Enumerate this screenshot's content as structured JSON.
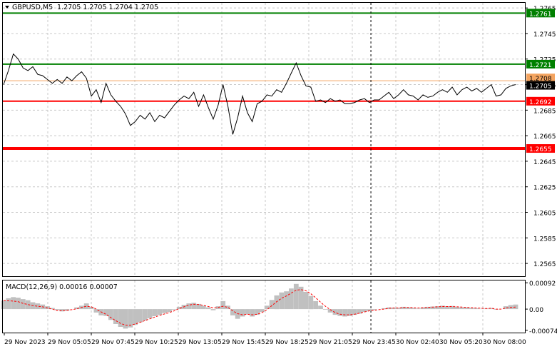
{
  "window": {
    "symbol_label": "GBPUSD,M5",
    "ohlc_label": "1.2705 1.2705 1.2704 1.2705",
    "dropdown_icon": "triangle-down-icon"
  },
  "colors": {
    "background": "#ffffff",
    "grid": "#c8c8c8",
    "price_line": "#000000",
    "support_resistance_red": "#ff0000",
    "target_green": "#008000",
    "ask_orange": "#f4a460",
    "macd_hist": "#c0c0c0",
    "macd_signal": "#ff0000",
    "border": "#000000"
  },
  "chart_data": [
    {
      "type": "line",
      "title": "GBPUSD,M5",
      "ylim": [
        1.2555,
        1.2769
      ],
      "y_ticks": [
        "1.2765",
        "1.2745",
        "1.2725",
        "1.2705",
        "1.2685",
        "1.2665",
        "1.2645",
        "1.2625",
        "1.2605",
        "1.2585",
        "1.2565"
      ],
      "x_ticks": [
        "29 Nov 2023",
        "29 Nov 05:05",
        "29 Nov 07:45",
        "29 Nov 10:25",
        "29 Nov 13:05",
        "29 Nov 15:45",
        "29 Nov 18:25",
        "29 Nov 21:05",
        "29 Nov 23:45",
        "30 Nov 02:40",
        "30 Nov 05:20",
        "30 Nov 08:00"
      ],
      "series": [
        {
          "values": [
            1.2705,
            1.2716,
            1.2729,
            1.2725,
            1.2718,
            1.2716,
            1.2719,
            1.2713,
            1.2712,
            1.2709,
            1.2706,
            1.2709,
            1.2706,
            1.2711,
            1.2708,
            1.2712,
            1.2715,
            1.271,
            1.2696,
            1.2701,
            1.2691,
            1.2706,
            1.2697,
            1.2692,
            1.2688,
            1.2682,
            1.2673,
            1.2676,
            1.2681,
            1.2678,
            1.2683,
            1.2676,
            1.2681,
            1.2679,
            1.2684,
            1.2689,
            1.2693,
            1.2696,
            1.2694,
            1.2699,
            1.2688,
            1.2697,
            1.2687,
            1.2678,
            1.2689,
            1.2705,
            1.2688,
            1.2666,
            1.2679,
            1.2696,
            1.2683,
            1.2676,
            1.269,
            1.2692,
            1.2697,
            1.2696,
            1.2701,
            1.2699,
            1.2706,
            1.2714,
            1.2722,
            1.2712,
            1.2704,
            1.2703,
            1.2692,
            1.2693,
            1.2691,
            1.2694,
            1.2692,
            1.2693,
            1.269,
            1.269,
            1.2691,
            1.2693,
            1.2694,
            1.2691,
            1.2693,
            1.2693,
            1.2696,
            1.2699,
            1.2694,
            1.2697,
            1.2701,
            1.2697,
            1.2696,
            1.2693,
            1.2697,
            1.2695,
            1.2696,
            1.2699,
            1.2701,
            1.2699,
            1.2703,
            1.2697,
            1.2701,
            1.2703,
            1.27,
            1.2702,
            1.2699,
            1.2702,
            1.2705,
            1.2696,
            1.2697,
            1.2702,
            1.2704,
            1.2705
          ]
        }
      ],
      "levels": [
        {
          "label": "1.2761",
          "value": 1.2761,
          "color": "green"
        },
        {
          "label": "1.2721",
          "value": 1.2721,
          "color": "green"
        },
        {
          "label": "1.2708",
          "value": 1.2708,
          "color": "orange"
        },
        {
          "label": "1.2705",
          "value": 1.2705,
          "color": "black"
        },
        {
          "label": "1.2692",
          "value": 1.2692,
          "color": "red"
        },
        {
          "label": "1.2655",
          "value": 1.2655,
          "color": "red"
        }
      ],
      "vertical_marker_fraction": 0.705,
      "grid": true
    },
    {
      "type": "bar",
      "title": "MACD(12,26,9) 0.00016 0.00007",
      "ylim": [
        -0.00082,
        0.001
      ],
      "y_ticks": [
        "0.00092",
        "0.00",
        "-0.00074"
      ],
      "histogram": [
        0.0003,
        0.00038,
        0.00042,
        0.0004,
        0.00035,
        0.00031,
        0.00024,
        0.0002,
        0.00016,
        0.0001,
        4e-05,
        -3e-05,
        -8e-05,
        -6e-05,
        0.0,
        6e-05,
        0.00012,
        0.0002,
        8e-05,
        -0.00012,
        -0.00022,
        -0.00024,
        -0.00038,
        -0.00052,
        -0.00062,
        -0.00068,
        -0.00064,
        -0.00055,
        -0.00046,
        -0.0004,
        -0.00032,
        -0.00025,
        -0.0002,
        -0.00014,
        -0.0001,
        -2e-05,
        8e-05,
        0.00015,
        0.0002,
        0.00022,
        0.00018,
        0.00012,
        6e-05,
        -4e-05,
        0.0001,
        0.00028,
        0.00012,
        -0.00022,
        -0.00034,
        -0.00026,
        -0.00018,
        -0.00026,
        -0.0002,
        -0.0001,
        0.00012,
        0.00032,
        0.00048,
        0.00058,
        0.00062,
        0.00072,
        0.00088,
        0.00078,
        0.0006,
        0.00046,
        0.00028,
        0.00012,
        -2e-05,
        -0.00012,
        -0.0002,
        -0.00024,
        -0.00026,
        -0.00024,
        -0.0002,
        -0.00016,
        -0.0001,
        -6e-05,
        -3e-05,
        0.0,
        3e-05,
        6e-05,
        5e-05,
        4e-05,
        8e-05,
        6e-05,
        4e-05,
        2e-05,
        6e-05,
        8e-05,
        9e-05,
        0.0001,
        0.00012,
        0.0001,
        0.00011,
        8e-05,
        6e-05,
        6e-05,
        4e-05,
        3e-05,
        1e-05,
        2e-05,
        4e-05,
        -2e-05,
        0.0,
        0.0001,
        0.00014,
        0.00016
      ],
      "signal": [
        0.0003,
        0.00029,
        0.00028,
        0.00026,
        0.0002,
        0.00016,
        0.00012,
        0.0001,
        8e-05,
        4e-05,
        0.0,
        -5e-05,
        -6e-05,
        -4e-05,
        -2e-05,
        1e-05,
        6e-05,
        0.0001,
        8e-05,
        0.0,
        -0.0001,
        -0.00018,
        -0.0003,
        -0.0004,
        -0.0005,
        -0.00056,
        -0.00056,
        -0.00052,
        -0.00046,
        -0.0004,
        -0.00034,
        -0.00028,
        -0.00022,
        -0.00017,
        -0.00012,
        -6e-05,
        2e-05,
        8e-05,
        0.00014,
        0.00017,
        0.00016,
        0.00013,
        9e-05,
        4e-05,
        6e-05,
        0.0001,
        6e-05,
        -6e-05,
        -0.00016,
        -0.0002,
        -0.00018,
        -0.0002,
        -0.00018,
        -0.00012,
        -2e-05,
        0.00012,
        0.00026,
        0.00038,
        0.00046,
        0.00056,
        0.00066,
        0.00068,
        0.00064,
        0.00054,
        0.0004,
        0.00024,
        0.0001,
        -2e-05,
        -0.00012,
        -0.00018,
        -0.0002,
        -0.0002,
        -0.00018,
        -0.00014,
        -0.0001,
        -6e-05,
        -4e-05,
        -2e-05,
        0.0,
        3e-05,
        4e-05,
        4e-05,
        6e-05,
        6e-05,
        5e-05,
        4e-05,
        5e-05,
        6e-05,
        7e-05,
        8e-05,
        9e-05,
        9e-05,
        9e-05,
        8e-05,
        7e-05,
        6e-05,
        5e-05,
        4e-05,
        3e-05,
        2e-05,
        3e-05,
        0.0,
        0.0,
        4e-05,
        6e-05,
        7e-05
      ]
    }
  ]
}
